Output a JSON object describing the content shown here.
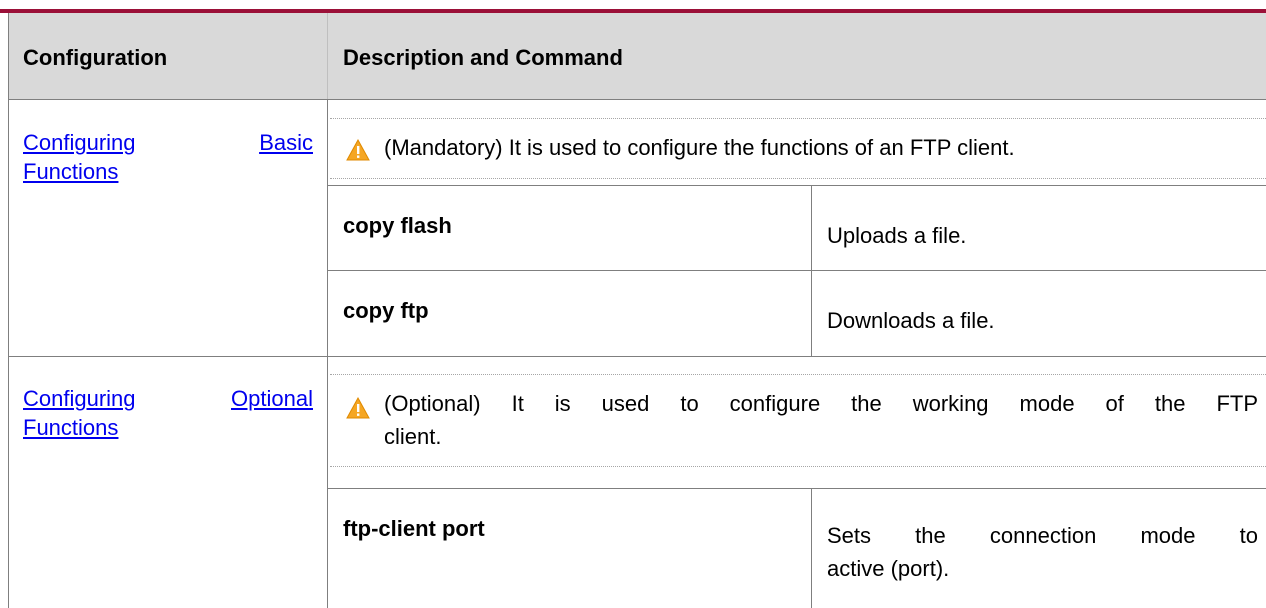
{
  "table": {
    "headers": {
      "configuration": "Configuration",
      "description": "Description and Command"
    },
    "sections": [
      {
        "configuration": {
          "line1_a": "Configuring",
          "line1_b": "Basic",
          "line2": "Functions"
        },
        "note": "(Mandatory) It is used to configure the functions of an FTP client.",
        "commands": [
          {
            "command": "copy flash",
            "description": "Uploads a file."
          },
          {
            "command": "copy ftp",
            "description": "Downloads a file."
          }
        ]
      },
      {
        "configuration": {
          "line1_a": "Configuring",
          "line1_b": "Optional",
          "line2": "Functions"
        },
        "note_line1": "(Optional) It is used to configure the working mode of the FTP",
        "note_line2": "client.",
        "commands": [
          {
            "command": "ftp-client port",
            "description_line1": "Sets the connection mode to",
            "description_line2": "active (port)."
          }
        ]
      }
    ]
  },
  "icons": {
    "warning": "warning-triangle-icon",
    "warning_color": "#f5a623"
  }
}
